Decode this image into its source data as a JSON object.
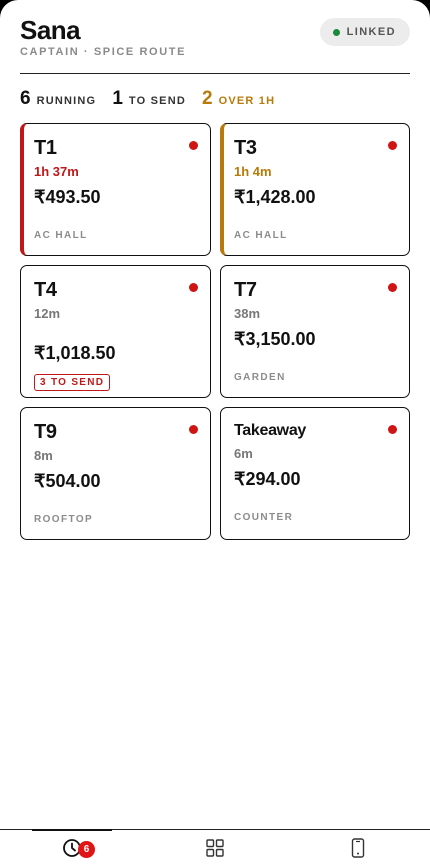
{
  "header": {
    "name": "Sana",
    "subtitle": "CAPTAIN · SPICE ROUTE",
    "status_label": "LINKED"
  },
  "stats": [
    {
      "value": "6",
      "label": "RUNNING"
    },
    {
      "value": "1",
      "label": "TO SEND"
    },
    {
      "value": "2",
      "label": "OVER 1H"
    }
  ],
  "tables": [
    {
      "name": "T1",
      "elapsed": "1h 37m",
      "amount": "₹493.50",
      "location": "AC HALL",
      "badge": ""
    },
    {
      "name": "T3",
      "elapsed": "1h 4m",
      "amount": "₹1,428.00",
      "location": "AC HALL",
      "badge": ""
    },
    {
      "name": "T4",
      "elapsed": "12m",
      "amount": "₹1,018.50",
      "location": "",
      "badge": "3 TO SEND"
    },
    {
      "name": "T7",
      "elapsed": "38m",
      "amount": "₹3,150.00",
      "location": "GARDEN",
      "badge": ""
    },
    {
      "name": "T9",
      "elapsed": "8m",
      "amount": "₹504.00",
      "location": "ROOFTOP",
      "badge": ""
    },
    {
      "name": "Takeaway",
      "elapsed": "6m",
      "amount": "₹294.00",
      "location": "COUNTER",
      "badge": ""
    }
  ],
  "nav": {
    "orders_badge": "6",
    "items": [
      {
        "icon": "clock-icon"
      },
      {
        "icon": "grid-icon"
      },
      {
        "icon": "phone-icon"
      }
    ]
  },
  "colors": {
    "late_red": "#c01818",
    "late_amber": "#b87a0a",
    "linked_green": "#1a8a3a",
    "alert_dot": "#d01414"
  }
}
